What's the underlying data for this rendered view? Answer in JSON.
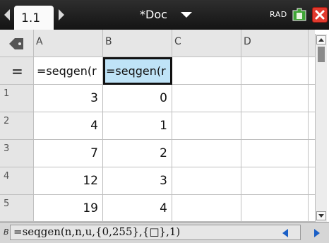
{
  "titlebar": {
    "tab_label": "1.1",
    "doc_title": "*Doc",
    "angle_mode": "RAD",
    "colors": {
      "close": "#e23a2e"
    }
  },
  "columns": [
    "A",
    "B",
    "C",
    "D",
    ""
  ],
  "formula_row": {
    "marker": "=",
    "cells": [
      "=seqgen(r",
      "=seqgen(r",
      "",
      "",
      ""
    ]
  },
  "rows": [
    {
      "index": "1",
      "values": [
        "3",
        "0",
        "",
        "",
        ""
      ]
    },
    {
      "index": "2",
      "values": [
        "4",
        "1",
        "",
        "",
        ""
      ]
    },
    {
      "index": "3",
      "values": [
        "7",
        "2",
        "",
        "",
        ""
      ]
    },
    {
      "index": "4",
      "values": [
        "12",
        "3",
        "",
        "",
        ""
      ]
    },
    {
      "index": "5",
      "values": [
        "19",
        "4",
        "",
        "",
        ""
      ]
    }
  ],
  "entry_line": {
    "cell_ref": "B",
    "text": "=seqgen(n,n,u,{0,255},{□},1)"
  },
  "icons": [
    "nav-left-icon",
    "nav-right-icon",
    "dropdown-caret-icon",
    "battery-icon",
    "close-icon",
    "tag-icon"
  ]
}
